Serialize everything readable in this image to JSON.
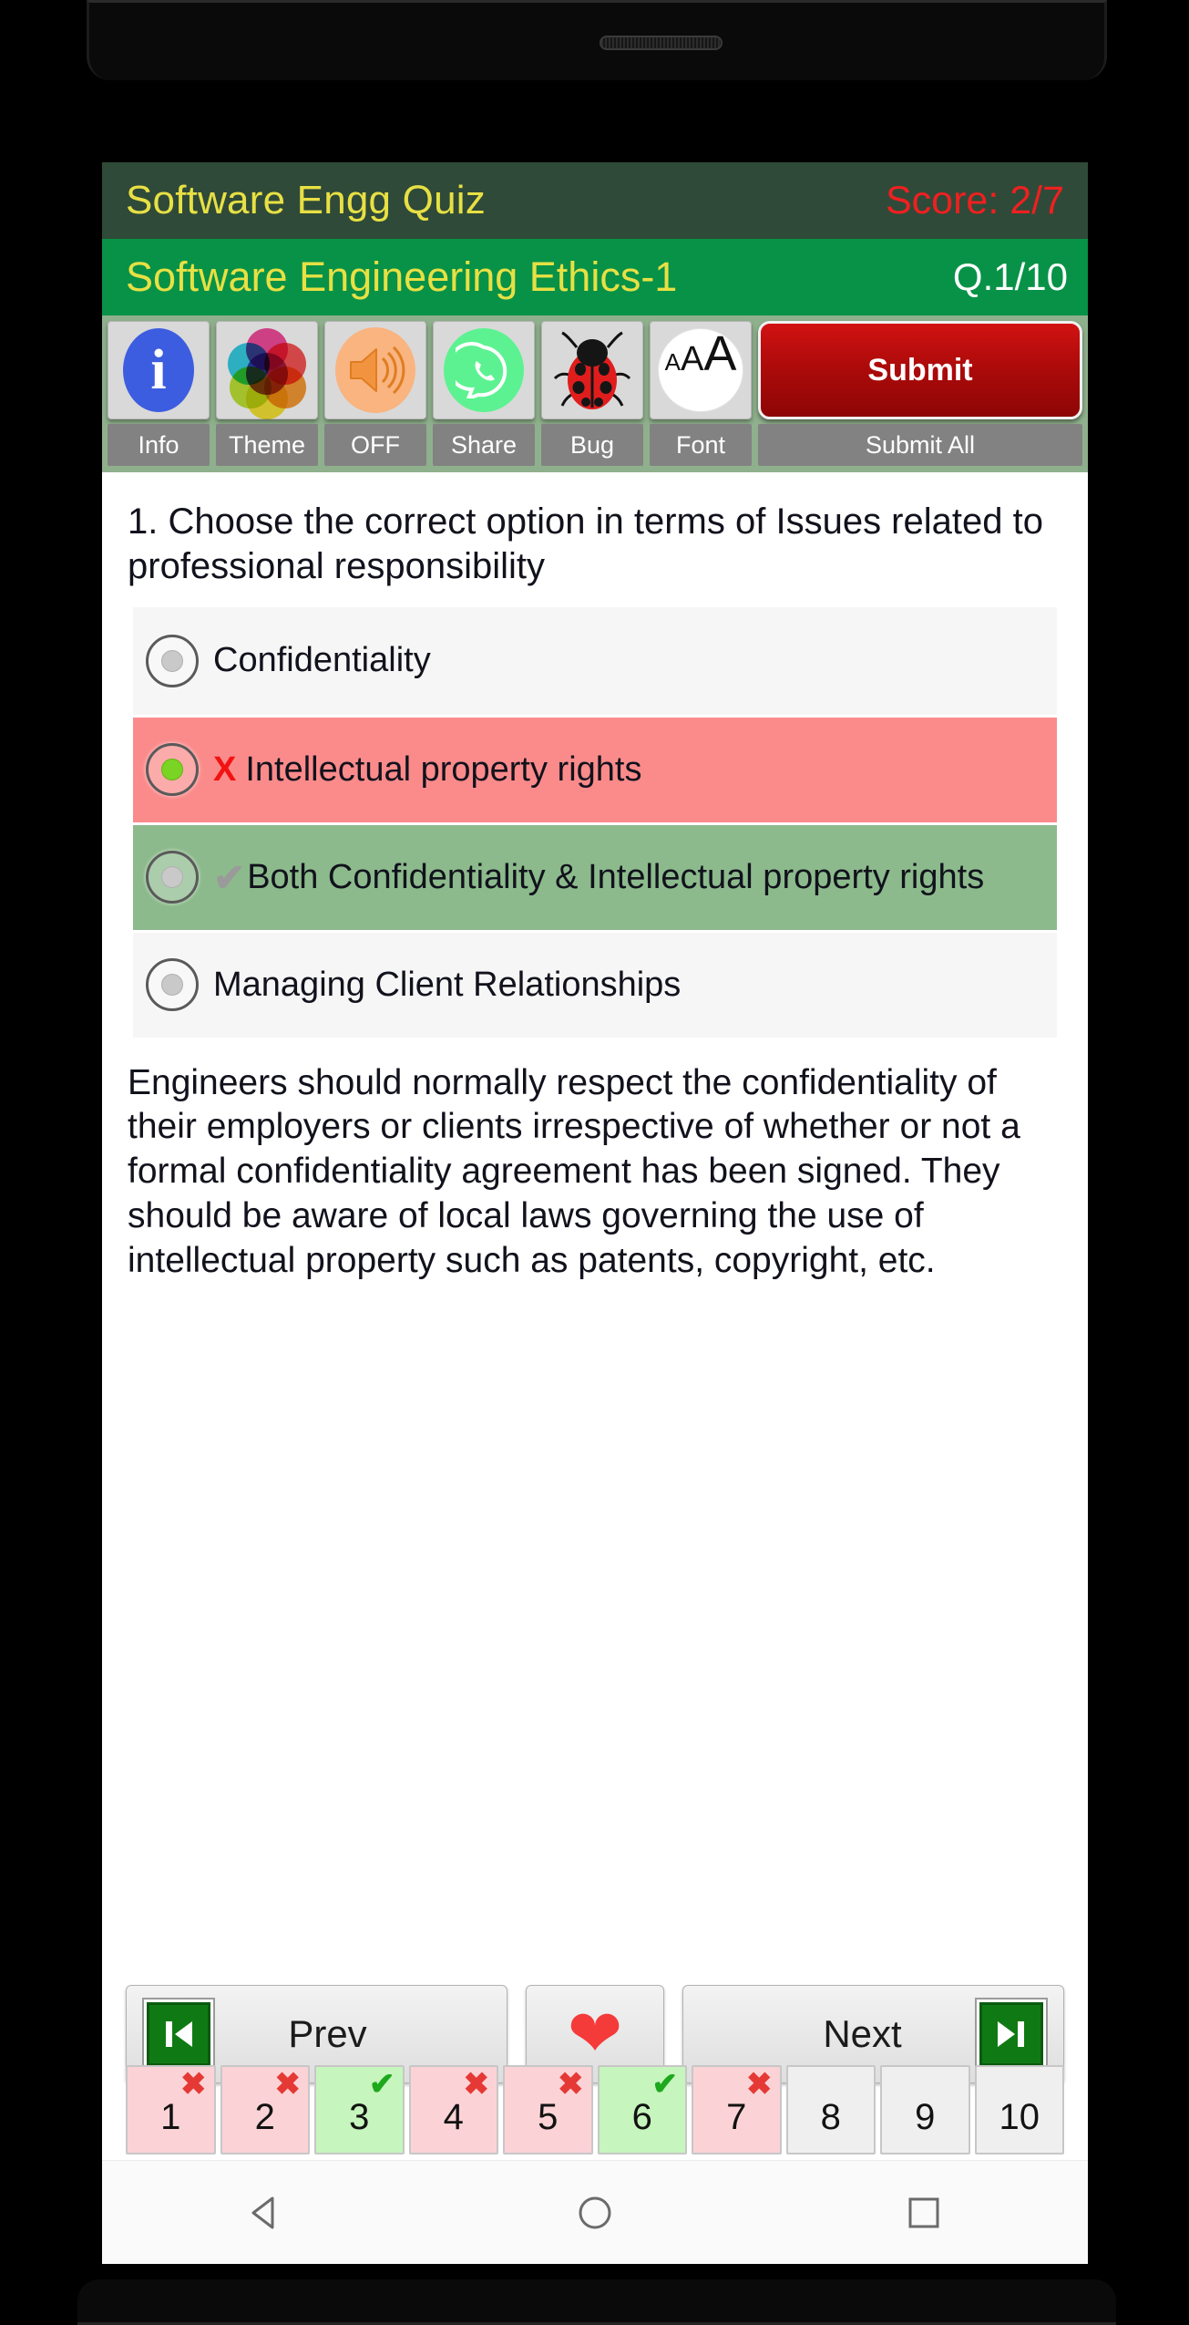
{
  "app": {
    "title": "Software Engg Quiz",
    "score": "Score: 2/7",
    "subject": "Software Engineering Ethics-1",
    "question_counter": "Q.1/10"
  },
  "toolbar": {
    "items": [
      {
        "icon": "info-icon",
        "label": "Info"
      },
      {
        "icon": "palette-icon",
        "label": "Theme"
      },
      {
        "icon": "speaker-icon",
        "label": "OFF"
      },
      {
        "icon": "whatsapp-icon",
        "label": "Share"
      },
      {
        "icon": "ladybug-icon",
        "label": "Bug"
      },
      {
        "icon": "font-size-icon",
        "label": "Font"
      }
    ],
    "submit_label": "Submit",
    "submit_all_label": "Submit All"
  },
  "question": {
    "text": "1. Choose the correct option in terms of Issues related to professional responsibility",
    "options": [
      {
        "label": "Confidentiality",
        "state": "neutral",
        "selected": false,
        "mark": ""
      },
      {
        "label": "Intellectual property rights",
        "state": "wrong",
        "selected": true,
        "mark": "X"
      },
      {
        "label": "Both Confidentiality & Intellectual property rights",
        "state": "correct",
        "selected": false,
        "mark": "✔"
      },
      {
        "label": "Managing Client Relationships",
        "state": "neutral",
        "selected": false,
        "mark": ""
      }
    ],
    "explanation": "Engineers should normally respect the confidentiality of their employers or clients irrespective of whether or not a formal confidentiality agreement has been signed. They should be aware of local laws governing the use of intellectual property such as patents, copyright, etc."
  },
  "nav": {
    "prev_label": "Prev",
    "next_label": "Next",
    "favorite_icon": "heart-icon",
    "prev_icon": "skip-previous-icon",
    "next_icon": "skip-next-icon"
  },
  "question_strip": [
    {
      "num": "1",
      "status": "bad",
      "badge": "✖"
    },
    {
      "num": "2",
      "status": "bad",
      "badge": "✖"
    },
    {
      "num": "3",
      "status": "ok",
      "badge": "✔"
    },
    {
      "num": "4",
      "status": "bad",
      "badge": "✖"
    },
    {
      "num": "5",
      "status": "bad",
      "badge": "✖"
    },
    {
      "num": "6",
      "status": "ok",
      "badge": "✔"
    },
    {
      "num": "7",
      "status": "bad",
      "badge": "✖"
    },
    {
      "num": "8",
      "status": "neutral",
      "badge": ""
    },
    {
      "num": "9",
      "status": "neutral",
      "badge": ""
    },
    {
      "num": "10",
      "status": "neutral",
      "badge": ""
    }
  ],
  "system_nav": {
    "back": "back-triangle-icon",
    "home": "home-circle-icon",
    "recents": "recents-square-icon"
  },
  "colors": {
    "titlebar": "#2f4a38",
    "subjectbar": "#079247",
    "title_text": "#e8e044",
    "score_text": "#ef2020",
    "wrong_row": "#fb8b8b",
    "correct_row": "#8cba8c",
    "submit": "#ac0a0a"
  }
}
